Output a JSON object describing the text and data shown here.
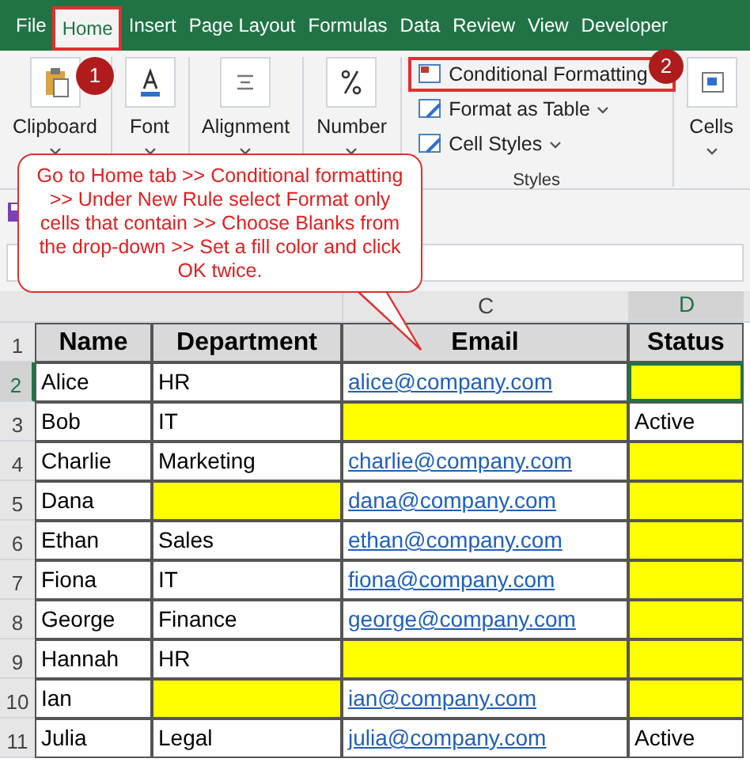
{
  "menu_tabs": [
    {
      "label": "File",
      "selected": false
    },
    {
      "label": "Home",
      "selected": true
    },
    {
      "label": "Insert",
      "selected": false
    },
    {
      "label": "Page Layout",
      "selected": false
    },
    {
      "label": "Formulas",
      "selected": false
    },
    {
      "label": "Data",
      "selected": false
    },
    {
      "label": "Review",
      "selected": false
    },
    {
      "label": "View",
      "selected": false
    },
    {
      "label": "Developer",
      "selected": false
    }
  ],
  "ribbon": {
    "groups": [
      {
        "kind": "big",
        "label": "Clipboard"
      },
      {
        "kind": "big",
        "label": "Font"
      },
      {
        "kind": "big",
        "label": "Alignment"
      },
      {
        "kind": "big",
        "label": "Number"
      },
      {
        "kind": "styles",
        "label": "Styles",
        "items": [
          {
            "label": "Conditional Formatting",
            "highlighted": true
          },
          {
            "label": "Format as Table",
            "highlighted": false
          },
          {
            "label": "Cell Styles",
            "highlighted": false
          }
        ]
      },
      {
        "kind": "big",
        "label": "Cells"
      }
    ]
  },
  "steps": [
    {
      "number": "1"
    },
    {
      "number": "2"
    }
  ],
  "callout": {
    "text": "Go to Home tab >> Conditional formatting >> Under New Rule select Format only cells that contain >> Choose Blanks from the drop-down >> Set a fill color and click OK twice."
  },
  "sheet": {
    "column_letters": [
      {
        "label": "C",
        "selected": false
      },
      {
        "label": "D",
        "selected": true
      }
    ],
    "headers": [
      "Name",
      "Department",
      "Email",
      "Status"
    ],
    "rows": [
      {
        "number": "2",
        "selected": true,
        "cells": [
          "Alice",
          "HR",
          "alice@company.com",
          null
        ]
      },
      {
        "number": "3",
        "selected": false,
        "cells": [
          "Bob",
          "IT",
          null,
          "Active"
        ]
      },
      {
        "number": "4",
        "selected": false,
        "cells": [
          "Charlie",
          "Marketing",
          "charlie@company.com",
          null
        ]
      },
      {
        "number": "5",
        "selected": false,
        "cells": [
          "Dana",
          null,
          "dana@company.com",
          null
        ]
      },
      {
        "number": "6",
        "selected": false,
        "cells": [
          "Ethan",
          "Sales",
          "ethan@company.com",
          null
        ]
      },
      {
        "number": "7",
        "selected": false,
        "cells": [
          "Fiona",
          "IT",
          "fiona@company.com",
          null
        ]
      },
      {
        "number": "8",
        "selected": false,
        "cells": [
          "George",
          "Finance",
          "george@company.com",
          null
        ]
      },
      {
        "number": "9",
        "selected": false,
        "cells": [
          "Hannah",
          "HR",
          null,
          null
        ]
      },
      {
        "number": "10",
        "selected": false,
        "cells": [
          "Ian",
          null,
          "ian@company.com",
          null
        ]
      },
      {
        "number": "11",
        "selected": false,
        "cells": [
          "Julia",
          "Legal",
          "julia@company.com",
          "Active"
        ]
      }
    ],
    "header_row_number": "1"
  }
}
